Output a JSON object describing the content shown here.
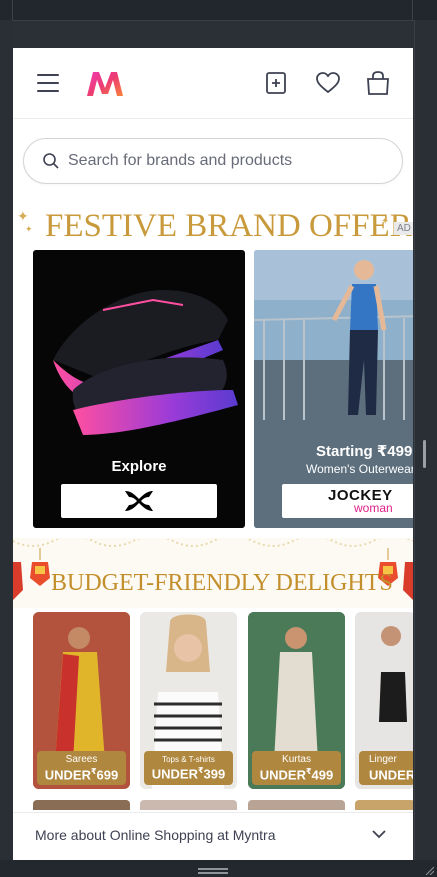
{
  "app": {
    "logo_letter": "M",
    "colors": {
      "accent": "#ff3f6c",
      "gold": "#c99a3b",
      "text": "#3e4152"
    }
  },
  "header": {
    "icons": [
      "menu-icon",
      "myntra-logo",
      "add-to-collection-icon",
      "heart-icon",
      "bag-icon"
    ]
  },
  "search": {
    "placeholder": "Search for brands and products"
  },
  "festive": {
    "title": "FESTIVE BRAND OFFERS",
    "ad_label": "AD",
    "cards": [
      {
        "cta": "Explore",
        "brand": "UNDER ARMOUR"
      },
      {
        "cta": "Starting ₹499",
        "subtitle": "Women's Outerwear",
        "brand": "JOCKEY",
        "brand_sub": "woman"
      }
    ]
  },
  "budget": {
    "title": "BUDGET-FRIENDLY DELIGHTS",
    "tiles": [
      {
        "category": "Sarees",
        "price_label": "UNDER",
        "currency": "₹",
        "price": "699"
      },
      {
        "category": "Tops & T-shirts",
        "price_label": "UNDER",
        "currency": "₹",
        "price": "399"
      },
      {
        "category": "Kurtas",
        "price_label": "UNDER",
        "currency": "₹",
        "price": "499"
      },
      {
        "category": "Linger",
        "price_label": "UNDER",
        "currency": "₹",
        "price": ""
      }
    ]
  },
  "footer": {
    "text": "More about Online Shopping at Myntra"
  }
}
